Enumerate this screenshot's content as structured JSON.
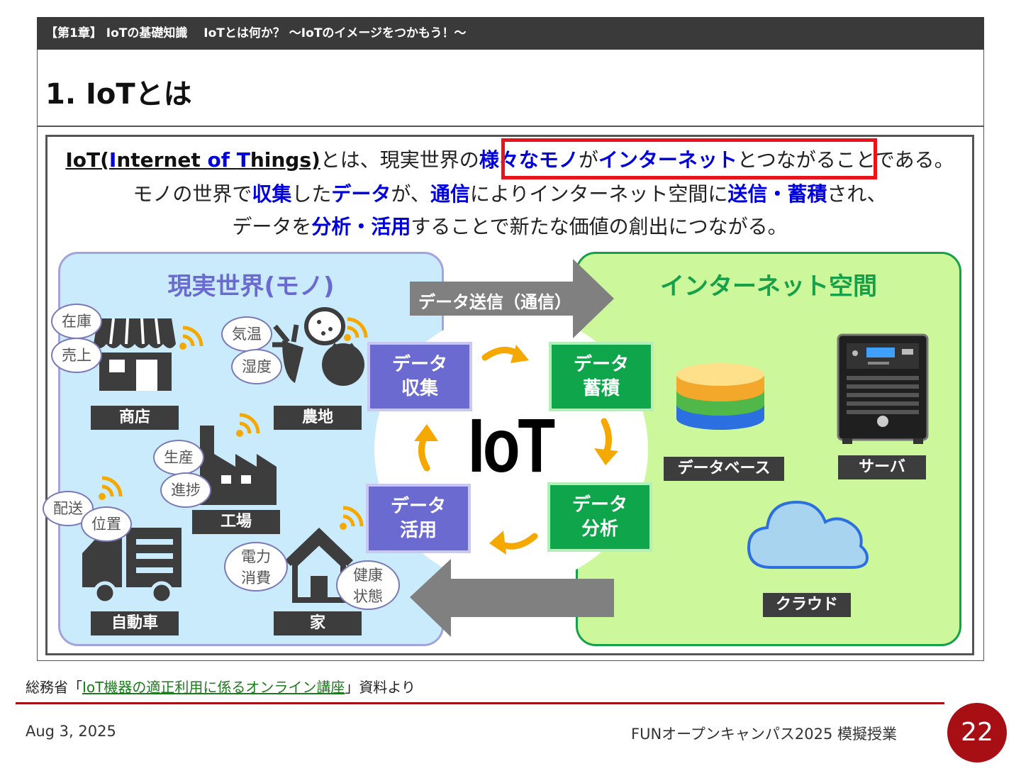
{
  "header": {
    "chapter": "【第1章】 IoTの基礎知識　 IoTとは何か？ ～IoTのイメージをつかもう！～",
    "title": "1. IoTとは"
  },
  "lead": {
    "line1_a": "IoT(",
    "line1_I": "I",
    "line1_nternet": "nternet ",
    "line1_of": "of",
    "line1_sp": " ",
    "line1_T": "T",
    "line1_hings": "hings)",
    "line1_b": "とは、現実世界の",
    "line1_hl1": "様々なモノ",
    "line1_c": "が",
    "line1_hl2": "インターネット",
    "line1_d": "とつながることである。",
    "line2_a": "モノの世界で",
    "line2_hl1": "収集",
    "line2_b": "した",
    "line2_hl2": "データ",
    "line2_c": "が、",
    "line2_hl3": "通信",
    "line2_d": "によりインターネット空間に",
    "line2_hl4": "送信・蓄積",
    "line2_e": "され、",
    "line3_a": "データを",
    "line3_hl1": "分析・活用",
    "line3_b": "することで新たな価値の創出につながる。"
  },
  "left_panel": {
    "title": "現実世界(モノ)",
    "labels": {
      "shop": "商店",
      "farm": "農地",
      "factory": "工場",
      "car": "自動車",
      "house": "家"
    },
    "bubbles": {
      "stock": "在庫",
      "sales": "売上",
      "temp": "気温",
      "humidity": "湿度",
      "production": "生産",
      "progress": "進捗",
      "delivery": "配送",
      "position": "位置",
      "power1": "電力",
      "power2": "消費",
      "health1": "健康",
      "health2": "状態"
    }
  },
  "right_panel": {
    "title": "インターネット空間",
    "labels": {
      "database": "データベース",
      "server": "サーバ",
      "cloud": "クラウド"
    }
  },
  "center": {
    "iot": "IoT",
    "send_arrow": "データ送信（通信）",
    "collect": [
      "データ",
      "収集"
    ],
    "store": [
      "データ",
      "蓄積"
    ],
    "analyze": [
      "データ",
      "分析"
    ],
    "use": [
      "データ",
      "活用"
    ]
  },
  "footer": {
    "source_pre": "総務省「",
    "source_link": "IoT機器の適正利用に係るオンライン講座",
    "source_post": "」資料より",
    "date": "Aug 3, 2025",
    "event": "FUNオープンキャンパス2025 模擬授業",
    "page": "22"
  },
  "colors": {
    "accent_red": "#a80f15",
    "highlight_blue": "#0000dd",
    "purple": "#6a6ad0",
    "green": "#0fa54b",
    "orange_arrow": "#f5a800"
  }
}
